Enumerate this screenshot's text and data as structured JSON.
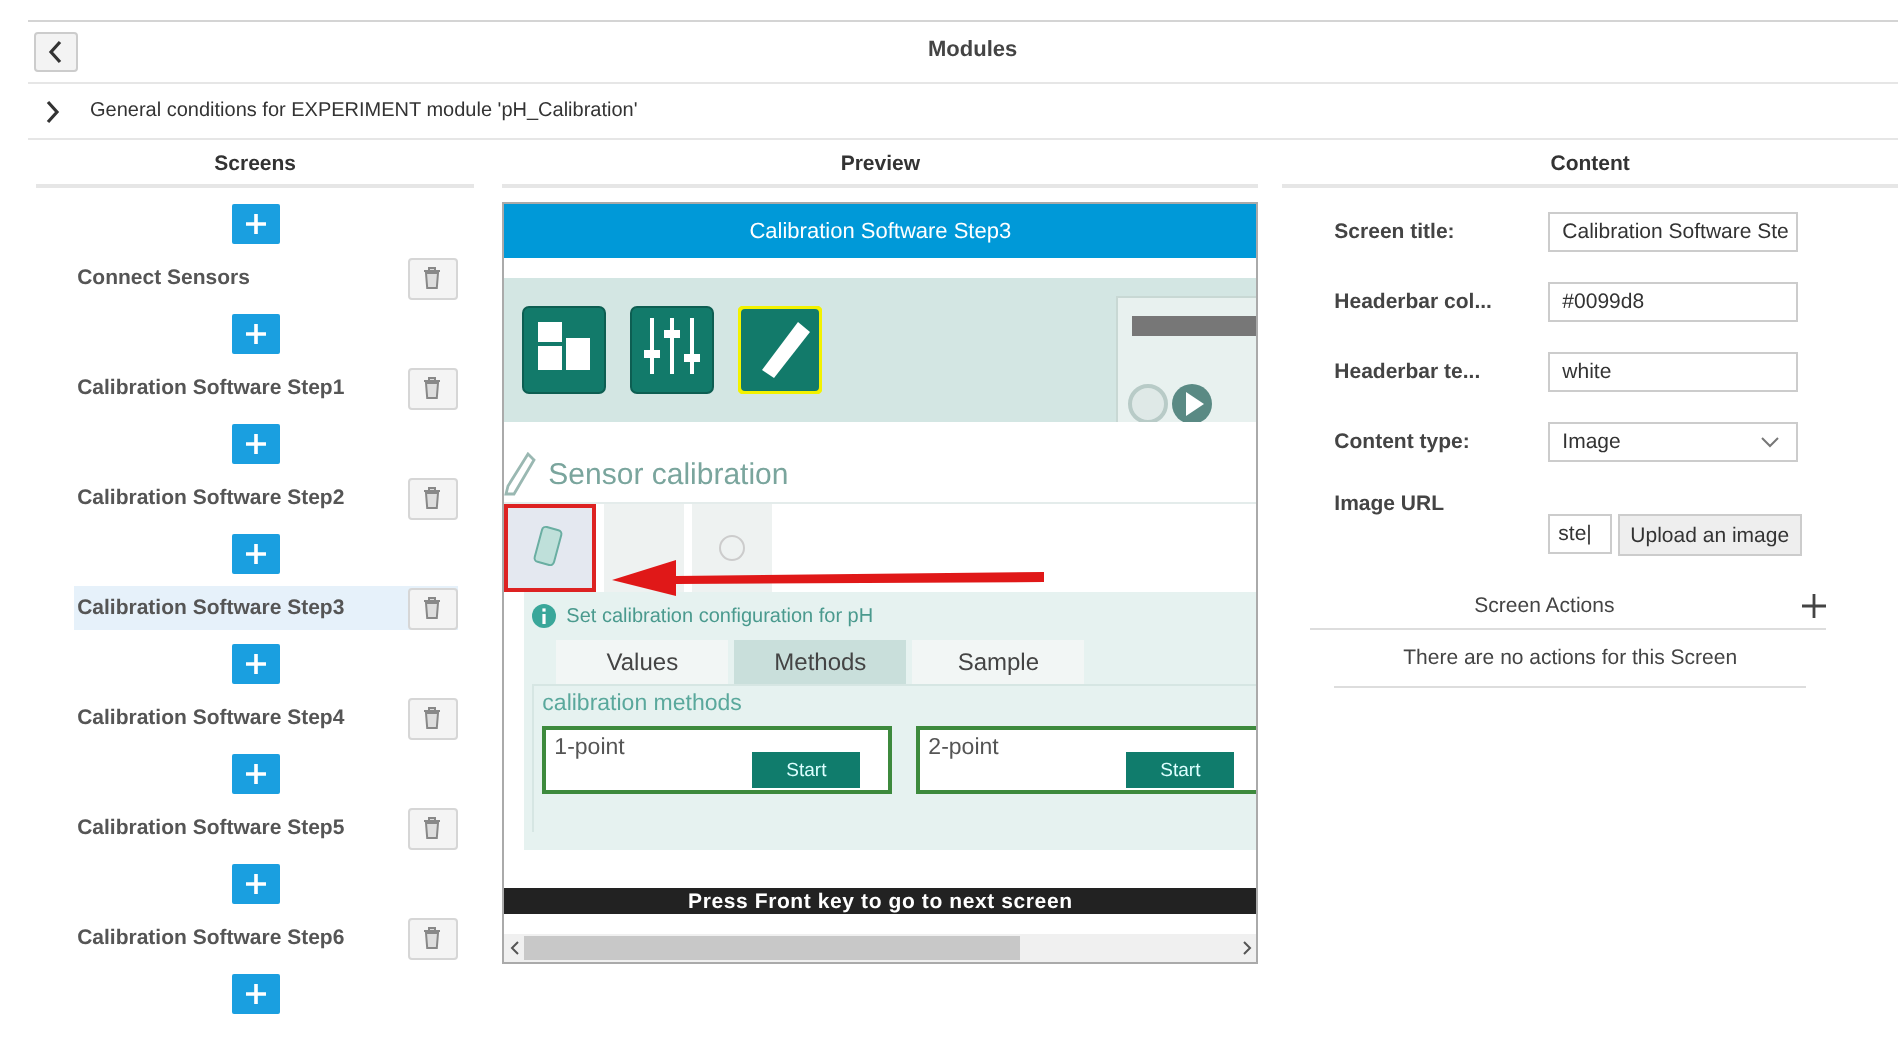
{
  "header": {
    "title": "Modules"
  },
  "breadcrumb": {
    "text": "General conditions for EXPERIMENT module 'pH_Calibration'",
    "expanded": false
  },
  "screens": {
    "heading": "Screens",
    "items": [
      {
        "label": "Connect Sensors",
        "selected": false
      },
      {
        "label": "Calibration Software Step1",
        "selected": false
      },
      {
        "label": "Calibration Software Step2",
        "selected": false
      },
      {
        "label": "Calibration Software Step3",
        "selected": true
      },
      {
        "label": "Calibration Software Step4",
        "selected": false
      },
      {
        "label": "Calibration Software Step5",
        "selected": false
      },
      {
        "label": "Calibration Software Step6",
        "selected": false
      }
    ]
  },
  "preview": {
    "heading": "Preview",
    "header_title": "Calibration Software Step3",
    "device": {
      "page_title": "Sensor calibration",
      "info": "Set calibration configuration for pH",
      "tabs": [
        {
          "label": "Values",
          "selected": false
        },
        {
          "label": "Methods",
          "selected": true
        },
        {
          "label": "Sample",
          "selected": false
        }
      ],
      "group_title": "calibration methods",
      "methods": [
        {
          "label": "1-point",
          "button": "Start"
        },
        {
          "label": "2-point",
          "button": "Start"
        }
      ]
    },
    "footer_text": "Press Front key to go to next screen"
  },
  "content": {
    "heading": "Content",
    "fields": [
      {
        "kind": "text",
        "label": "Screen title:",
        "value": "Calibration Software Ste"
      },
      {
        "kind": "text",
        "label": "Headerbar col...",
        "value": "#0099d8"
      },
      {
        "kind": "text",
        "label": "Headerbar te...",
        "value": "white"
      },
      {
        "kind": "select",
        "label": "Content type:",
        "value": "Image"
      },
      {
        "kind": "upload",
        "label": "Image URL",
        "value": "ste|",
        "button": "Upload an image"
      }
    ],
    "actions": {
      "heading": "Screen Actions",
      "empty_text": "There are no actions for this Screen"
    }
  }
}
